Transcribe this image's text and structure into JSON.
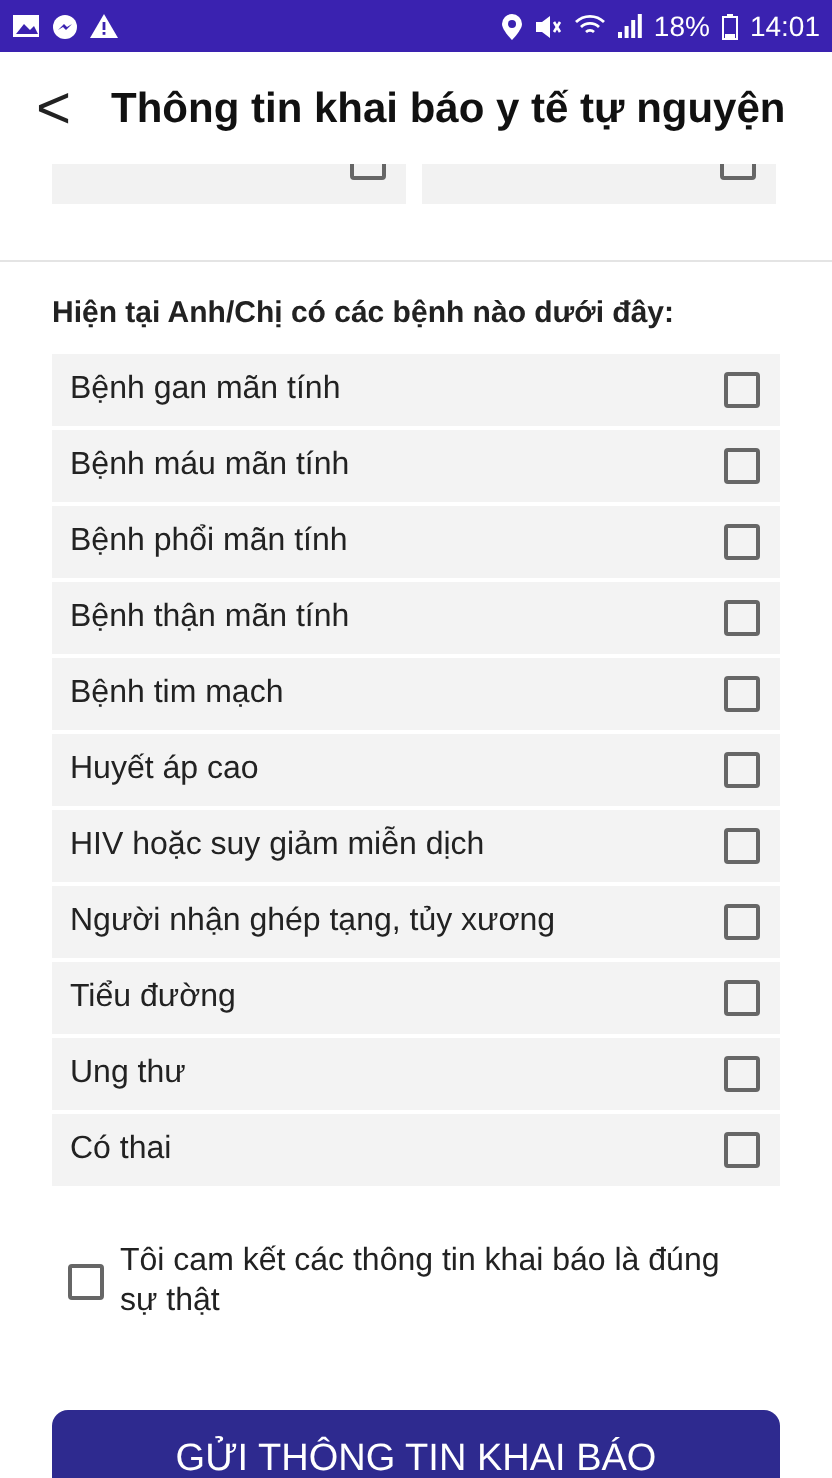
{
  "status_bar": {
    "battery": "18%",
    "time": "14:01"
  },
  "header": {
    "back": "<",
    "title": "Thông tin khai báo y tế tự nguyện"
  },
  "partial_items": [
    {
      "checked": false
    },
    {
      "checked": false
    }
  ],
  "question": "Hiện tại Anh/Chị có các bệnh nào dưới đây:",
  "conditions": [
    {
      "label": "Bệnh gan mãn tính",
      "checked": false
    },
    {
      "label": "Bệnh máu mãn tính",
      "checked": false
    },
    {
      "label": "Bệnh phổi mãn tính",
      "checked": false
    },
    {
      "label": "Bệnh thận mãn tính",
      "checked": false
    },
    {
      "label": "Bệnh tim mạch",
      "checked": false
    },
    {
      "label": "Huyết áp cao",
      "checked": false
    },
    {
      "label": "HIV hoặc suy giảm miễn dịch",
      "checked": false
    },
    {
      "label": "Người nhận ghép tạng, tủy xương",
      "checked": false
    },
    {
      "label": "Tiểu đường",
      "checked": false
    },
    {
      "label": "Ung thư",
      "checked": false
    },
    {
      "label": "Có thai",
      "checked": false
    }
  ],
  "commitment": {
    "label": "Tôi cam kết các thông tin khai báo là đúng sự thật",
    "checked": false
  },
  "submit": "GỬI THÔNG TIN KHAI BÁO"
}
